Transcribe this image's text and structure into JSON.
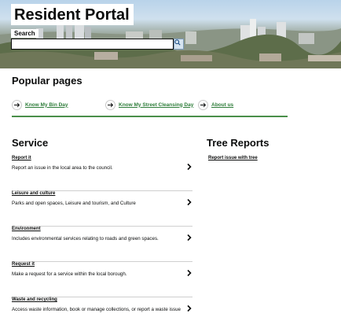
{
  "header": {
    "site_title": "Resident Portal",
    "search_label": "Search",
    "search_value": "",
    "search_icon": "search-icon"
  },
  "popular": {
    "title": "Popular pages",
    "links": [
      {
        "label": "Know My Bin Day",
        "icon": "arrow-right-icon"
      },
      {
        "label": "Know My Street Cleansing Day",
        "icon": "arrow-right-icon"
      },
      {
        "label": "About us",
        "icon": "arrow-right-icon"
      }
    ]
  },
  "service": {
    "title": "Service",
    "items": [
      {
        "title": "Report it",
        "description": "Report an issue in the local area to the council."
      },
      {
        "title": "Leisure and culture",
        "description": "Parks and open spaces, Leisure and tourism, and Culture"
      },
      {
        "title": "Environment",
        "description": "Includes environmental services relating to roads and green spaces."
      },
      {
        "title": "Request it",
        "description": "Make a request for a service within the local borough."
      },
      {
        "title": "Waste and recycling",
        "description": "Access waste information, book or manage collections, or report a waste issue"
      }
    ]
  },
  "tree_reports": {
    "title": "Tree Reports",
    "link": "Report issue with tree"
  },
  "colors": {
    "link_green": "#2e7d3a",
    "rule_green": "#4a8f4a",
    "text": "#0b0c0c"
  }
}
